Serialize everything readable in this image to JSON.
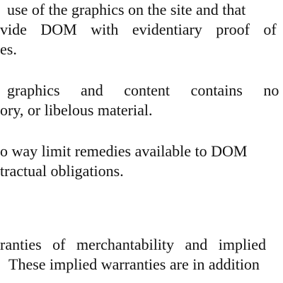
{
  "document": {
    "lines": [
      "use of the graphics on the site and that",
      "vide DOM with evidentiary proof of",
      "es.",
      "graphics and content contains no",
      "ory, or libelous material.",
      "o way limit remedies available to DOM",
      "tractual obligations.",
      "ranties of merchantability and implied",
      "These implied warranties are in addition"
    ]
  }
}
